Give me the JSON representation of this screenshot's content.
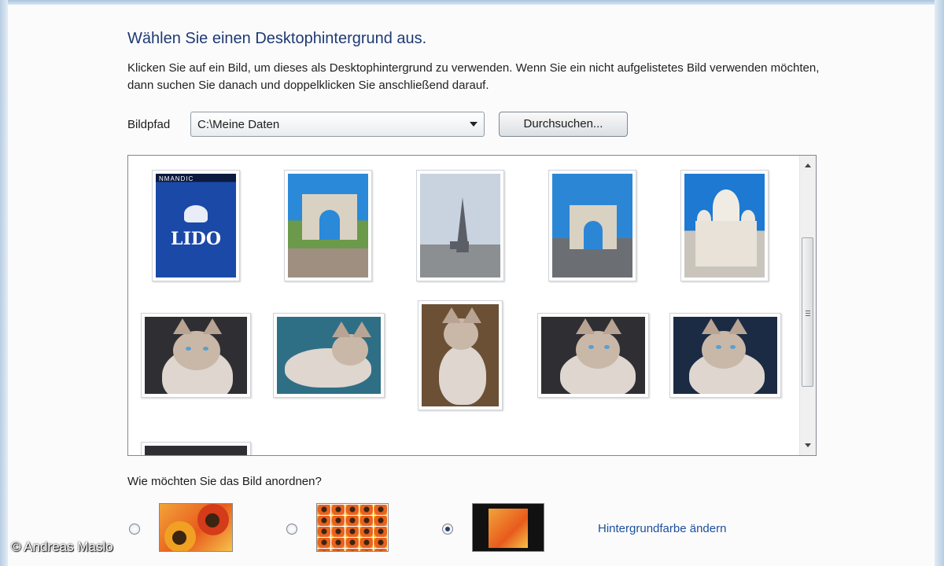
{
  "dialog": {
    "title": "Wählen Sie einen Desktophintergrund aus.",
    "description": "Klicken Sie auf ein Bild, um dieses als Desktophintergrund zu verwenden. Wenn Sie ein nicht aufgelistetes Bild verwenden möchten, dann suchen Sie danach und doppelklicken Sie anschließend darauf."
  },
  "path": {
    "label": "Bildpfad",
    "value": "C:\\Meine Daten",
    "browse_label": "Durchsuchen..."
  },
  "gallery": {
    "lido_text": "LIDO",
    "lido_top_text": "NMANDIC"
  },
  "arrange": {
    "label": "Wie möchten Sie das Bild anordnen?",
    "selected": "center"
  },
  "background_color_link": "Hintergrundfarbe ändern",
  "copyright": "© Andreas Maslo",
  "colors": {
    "title": "#1e3a73",
    "link": "#1c4f9c"
  }
}
